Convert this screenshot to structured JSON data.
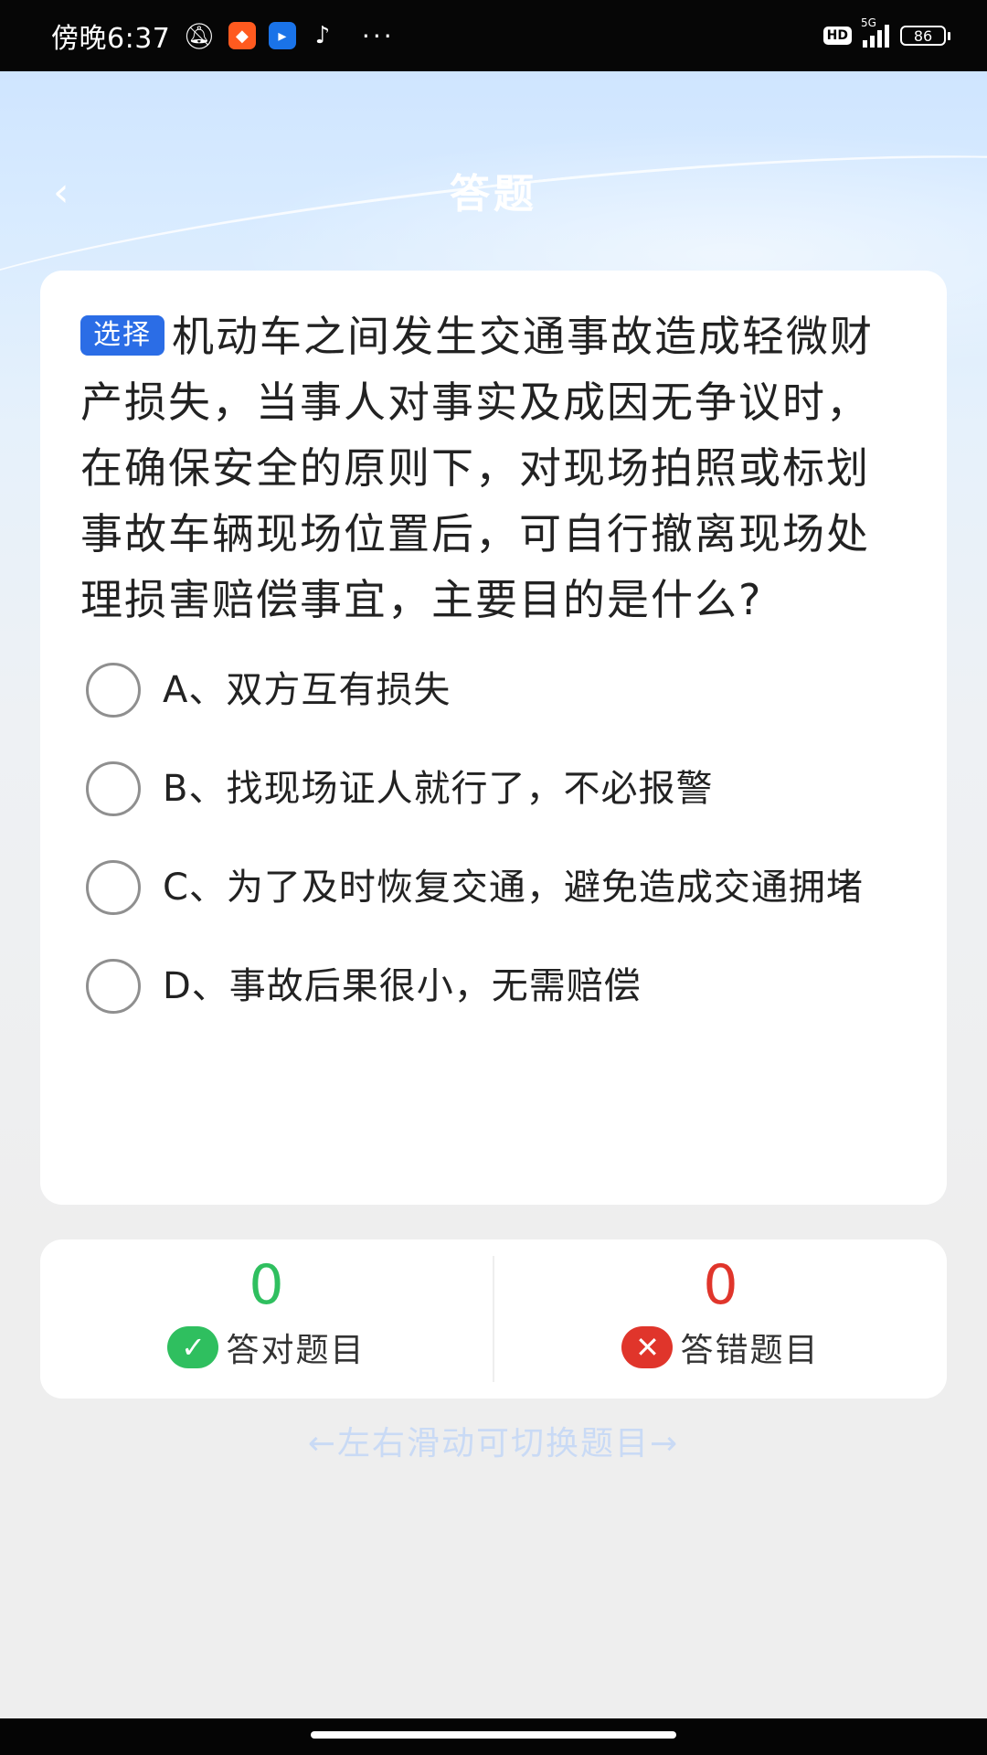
{
  "status_bar": {
    "time": "傍晚6:37",
    "notif_icons": [
      "mute-icon",
      "app-orange-icon",
      "app-blue-icon",
      "tiktok-icon"
    ],
    "more": "···",
    "hd": "HD",
    "network": "5G",
    "battery": "86"
  },
  "header": {
    "back_icon": "back-chevron-icon",
    "title": "答题"
  },
  "question": {
    "type_badge": "选择",
    "text": "机动车之间发生交通事故造成轻微财产损失，当事人对事实及成因无争议时，在确保安全的原则下，对现场拍照或标划事故车辆现场位置后，可自行撤离现场处理损害赔偿事宜，主要目的是什么?",
    "options": [
      {
        "label": "A、双方互有损失"
      },
      {
        "label": "B、找现场证人就行了，不必报警"
      },
      {
        "label": "C、为了及时恢复交通，避免造成交通拥堵"
      },
      {
        "label": "D、事故后果很小，无需赔偿"
      }
    ]
  },
  "score": {
    "correct_count": "0",
    "correct_label": "答对题目",
    "wrong_count": "0",
    "wrong_label": "答错题目",
    "colors": {
      "correct": "#2fbf5f",
      "wrong": "#e0352b"
    }
  },
  "hint": {
    "text": "←左右滑动可切换题目→"
  },
  "colors": {
    "accent": "#2b6de6",
    "status_bar_bg": "#060606"
  }
}
